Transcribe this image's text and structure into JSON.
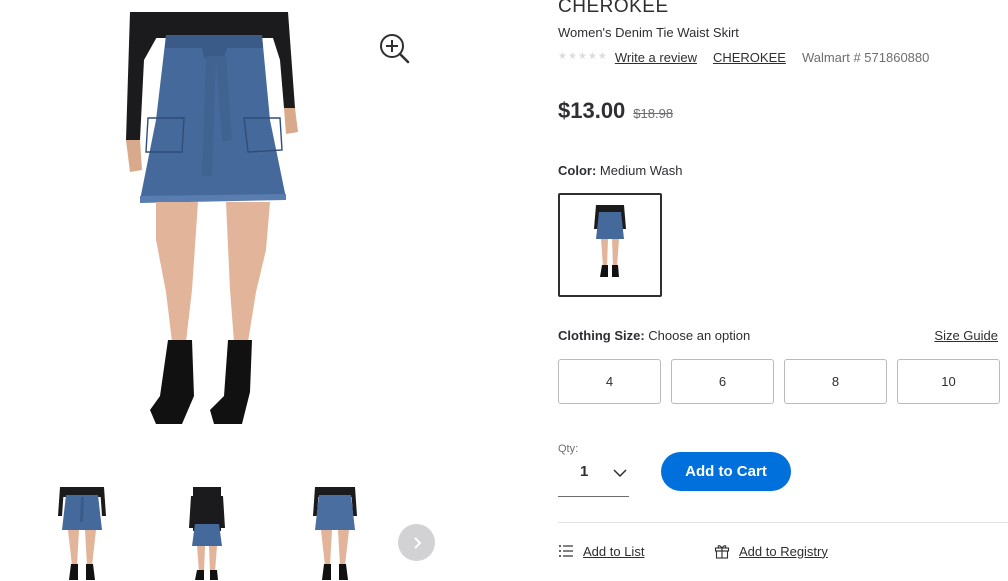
{
  "product": {
    "brand_heading": "CHEROKEE",
    "name": "Women's Denim Tie Waist Skirt",
    "rating": {
      "stars_filled": 0,
      "stars_total": 5
    },
    "write_review": "Write a review",
    "brand_link": "CHEROKEE",
    "walmart_number": "Walmart # 571860880",
    "price": "$13.00",
    "old_price": "$18.98"
  },
  "color": {
    "label": "Color:",
    "value": "Medium Wash"
  },
  "size": {
    "label": "Clothing Size:",
    "placeholder": "Choose an option",
    "guide": "Size Guide",
    "options": [
      "4",
      "6",
      "8",
      "10"
    ]
  },
  "quantity": {
    "label": "Qty:",
    "value": "1"
  },
  "actions": {
    "add_to_cart": "Add to Cart",
    "add_to_list": "Add to List",
    "add_to_registry": "Add to Registry"
  },
  "icons": {
    "zoom": "zoom-in-icon",
    "next": "chevron-right-icon",
    "qty": "chevron-down-icon",
    "list": "list-icon",
    "registry": "gift-icon"
  },
  "colors": {
    "accent": "#0071dc",
    "denim": "#46699b",
    "text": "#2e2f32",
    "muted": "#6d6e71"
  }
}
